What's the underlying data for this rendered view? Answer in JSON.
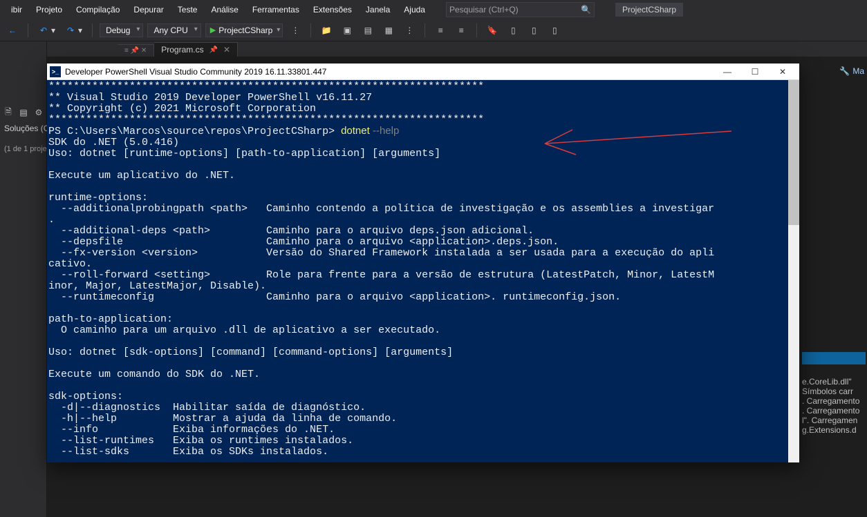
{
  "menu": {
    "items": [
      "ibir",
      "Projeto",
      "Compilação",
      "Depurar",
      "Teste",
      "Análise",
      "Ferramentas",
      "Extensões",
      "Janela",
      "Ajuda"
    ]
  },
  "search": {
    "placeholder": "Pesquisar (Ctrl+Q)"
  },
  "project_label": "ProjectCSharp",
  "toolbar": {
    "config": "Debug",
    "platform": "Any CPU",
    "run": "ProjectCSharp"
  },
  "tabs": {
    "active": "Program.cs"
  },
  "solution": {
    "title": "Soluções (Ct",
    "sub": "(1 de 1 proje"
  },
  "right_head": "Ma",
  "right_output": [
    "e.CoreLib.dll\"",
    " Símbolos carr",
    ". Carregamento",
    ". Carregamento",
    "l\". Carregamen",
    "g.Extensions.d"
  ],
  "psh": {
    "title": "Developer PowerShell Visual Studio Community 2019 16.11.33801.447",
    "prompt": "PS C:\\Users\\Marcos\\source\\repos\\ProjectCSharp> ",
    "cmd": "dotnet ",
    "flag": "--help",
    "lines_top": [
      "**********************************************************************",
      "** Visual Studio 2019 Developer PowerShell v16.11.27",
      "** Copyright (c) 2021 Microsoft Corporation",
      "**********************************************************************"
    ],
    "lines_rest": [
      "SDK do .NET (5.0.416)",
      "Uso: dotnet [runtime-options] [path-to-application] [arguments]",
      "",
      "Execute um aplicativo do .NET.",
      "",
      "runtime-options:",
      "  --additionalprobingpath <path>   Caminho contendo a política de investigação e os assemblies a investigar",
      ".",
      "  --additional-deps <path>         Caminho para o arquivo deps.json adicional.",
      "  --depsfile                       Caminho para o arquivo <application>.deps.json.",
      "  --fx-version <version>           Versão do Shared Framework instalada a ser usada para a execução do apli",
      "cativo.",
      "  --roll-forward <setting>         Role para frente para a versão de estrutura (LatestPatch, Minor, LatestM",
      "inor, Major, LatestMajor, Disable).",
      "  --runtimeconfig                  Caminho para o arquivo <application>. runtimeconfig.json.",
      "",
      "path-to-application:",
      "  O caminho para um arquivo .dll de aplicativo a ser executado.",
      "",
      "Uso: dotnet [sdk-options] [command] [command-options] [arguments]",
      "",
      "Execute um comando do SDK do .NET.",
      "",
      "sdk-options:",
      "  -d|--diagnostics  Habilitar saída de diagnóstico.",
      "  -h|--help         Mostrar a ajuda da linha de comando.",
      "  --info            Exiba informações do .NET.",
      "  --list-runtimes   Exiba os runtimes instalados.",
      "  --list-sdks       Exiba os SDKs instalados."
    ]
  }
}
